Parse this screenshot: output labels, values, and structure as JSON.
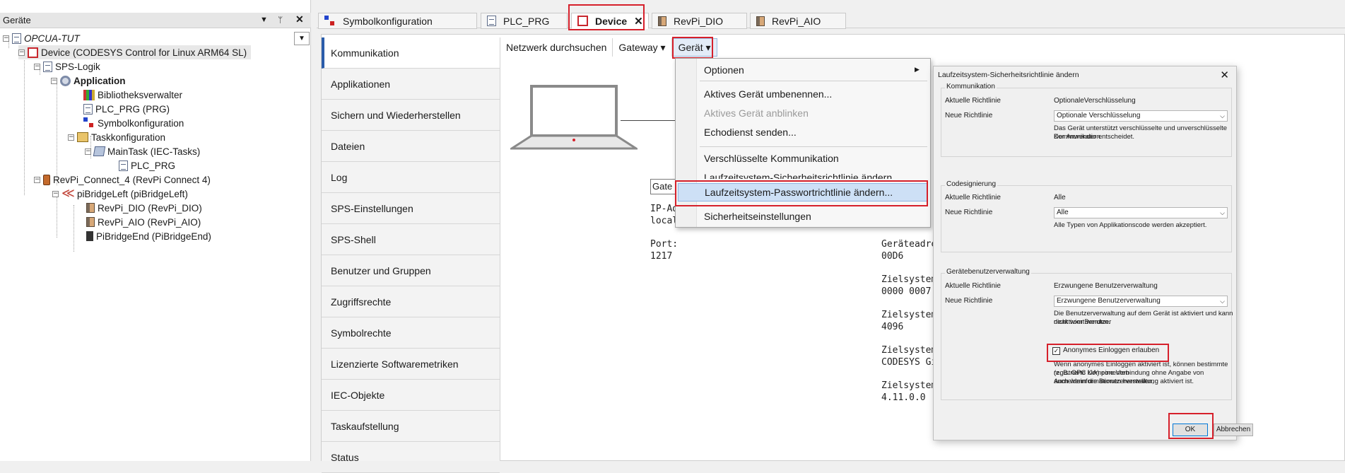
{
  "devices": {
    "title": "Geräte",
    "pin": "ᛘ",
    "close": "✕",
    "menu": "▼",
    "tree": [
      {
        "label": "OPCUA-TUT",
        "icon": "project-icon"
      },
      {
        "label": "Device (CODESYS Control for Linux ARM64 SL)",
        "icon": "device-icon"
      },
      {
        "label": "SPS-Logik",
        "icon": "plc-logic-icon"
      },
      {
        "label": "Application",
        "icon": "application-gear-icon"
      },
      {
        "label": "Bibliotheksverwalter",
        "icon": "library-icon"
      },
      {
        "label": "PLC_PRG (PRG)",
        "icon": "program-icon"
      },
      {
        "label": "Symbolkonfiguration",
        "icon": "symbol-config-icon"
      },
      {
        "label": "Taskkonfiguration",
        "icon": "task-config-icon"
      },
      {
        "label": "MainTask (IEC-Tasks)",
        "icon": "main-task-icon"
      },
      {
        "label": "PLC_PRG",
        "icon": "program-call-icon"
      },
      {
        "label": "RevPi_Connect_4 (RevPi Connect 4)",
        "icon": "revpi-icon"
      },
      {
        "label": "piBridgeLeft (piBridgeLeft)",
        "icon": "pibridge-icon"
      },
      {
        "label": "RevPi_DIO (RevPi_DIO)",
        "icon": "module-icon"
      },
      {
        "label": "RevPi_AIO (RevPi_AIO)",
        "icon": "module-icon"
      },
      {
        "label": "PiBridgeEnd (PiBridgeEnd)",
        "icon": "bridge-end-icon"
      }
    ]
  },
  "tabs": [
    {
      "label": "Symbolkonfiguration"
    },
    {
      "label": "PLC_PRG"
    },
    {
      "label": "Device",
      "close": "✕"
    },
    {
      "label": "RevPi_DIO"
    },
    {
      "label": "RevPi_AIO"
    }
  ],
  "nav": [
    "Kommunikation",
    "Applikationen",
    "Sichern und Wiederherstellen",
    "Dateien",
    "Log",
    "SPS-Einstellungen",
    "SPS-Shell",
    "Benutzer und Gruppen",
    "Zugriffsrechte",
    "Symbolrechte",
    "Lizenzierte Softwaremetriken",
    "IEC-Objekte",
    "Taskaufstellung",
    "Status"
  ],
  "toolbar": {
    "scan": "Netzwerk durchsuchen",
    "gateway": "Gateway",
    "device": "Gerät",
    "arrow": "▾"
  },
  "network": {
    "gateway_field": "Gate",
    "ip_label": "IP-Ad",
    "ip_value": "locali",
    "port_label": "Port:",
    "port_value": "1217",
    "addr_label": "Geräteadres",
    "addr_value": "00D6",
    "target_id_label": "Zielsystem-",
    "target_id_value": "0000 0007",
    "target_type_label": "Zielsystemty",
    "target_type_value": "4096",
    "vendor_label": "Zielsystemh",
    "vendor_value": "CODESYS Gi",
    "version_label": "Zielsystemv",
    "version_value": "4.11.0.0"
  },
  "menu": {
    "optionen": "Optionen",
    "submenu_arrow": "▶",
    "rename": "Aktives Gerät umbenennen...",
    "blink": "Aktives Gerät anblinken",
    "echo": "Echodienst senden...",
    "encrypted": "Verschlüsselte Kommunikation",
    "security_policy": "Laufzeitsystem-Sicherheitsrichtlinie ändern...",
    "password_policy": "Laufzeitsystem-Passwortrichtlinie ändern...",
    "security_settings": "Sicherheitseinstellungen"
  },
  "dialog": {
    "title": "Laufzeitsystem-Sicherheitsrichtlinie ändern",
    "close": "✕",
    "comm": {
      "group": "Kommunikation",
      "current_label": "Aktuelle Richtlinie",
      "current_value": "OptionaleVerschlüsselung",
      "new_label": "Neue Richtlinie",
      "new_value": "Optionale Verschlüsselung",
      "desc1": "Das Gerät unterstützt verschlüsselte und unverschlüsselte Kommunikation.",
      "desc2": "Der Anwender entscheidet."
    },
    "codesign": {
      "group": "Codesignierung",
      "current_label": "Aktuelle Richtlinie",
      "current_value": "Alle",
      "new_label": "Neue Richtlinie",
      "new_value": "Alle",
      "desc": "Alle Typen von Applikationscode werden akzeptiert."
    },
    "usermgmt": {
      "group": "Gerätebenutzerverwaltung",
      "current_label": "Aktuelle Richtlinie",
      "current_value": "Erzwungene Benutzerverwaltung",
      "new_label": "Neue Richtlinie",
      "new_value": "Erzwungene Benutzerverwaltung",
      "desc1": "Die Benutzerverwaltung auf dem Gerät ist aktiviert und kann nicht vom Benutzer",
      "desc2": "deaktiviert werden.",
      "anon_label": "Anonymes Einloggen erlauben",
      "anon_checked": true,
      "anon_desc1": "Wenn anonymes Einloggen aktiviert ist, können bestimmte registrierte Komponenten",
      "anon_desc2": "(z. B. OPC UA) eine Verbindung ohne Angabe von Anmeldeinformationen herstellen,",
      "anon_desc3": "auch wenn die Benutzerverwaltung aktiviert ist."
    },
    "ok": "OK",
    "cancel": "Abbrechen",
    "combo_arrow": "⌵",
    "check_mark": "✓"
  }
}
